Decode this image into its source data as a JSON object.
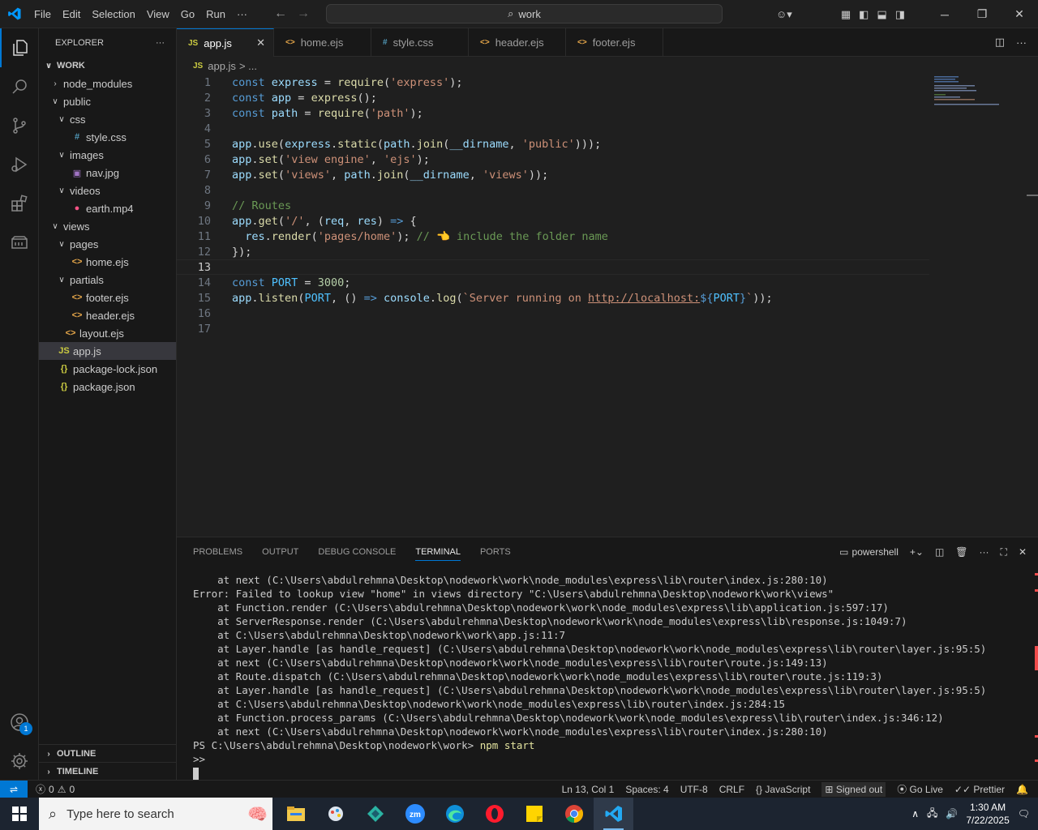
{
  "titlebar": {
    "menu": [
      "File",
      "Edit",
      "Selection",
      "View",
      "Go",
      "Run",
      "···"
    ],
    "search_text": "work"
  },
  "sidebar": {
    "title": "EXPLORER",
    "root": "WORK",
    "tree": [
      {
        "label": "node_modules",
        "indent": 1,
        "type": "folder-closed"
      },
      {
        "label": "public",
        "indent": 1,
        "type": "folder-open"
      },
      {
        "label": "css",
        "indent": 2,
        "type": "folder-open"
      },
      {
        "label": "style.css",
        "indent": 3,
        "type": "css"
      },
      {
        "label": "images",
        "indent": 2,
        "type": "folder-open"
      },
      {
        "label": "nav.jpg",
        "indent": 3,
        "type": "image"
      },
      {
        "label": "videos",
        "indent": 2,
        "type": "folder-open"
      },
      {
        "label": "earth.mp4",
        "indent": 3,
        "type": "video"
      },
      {
        "label": "views",
        "indent": 1,
        "type": "folder-open"
      },
      {
        "label": "pages",
        "indent": 2,
        "type": "folder-open"
      },
      {
        "label": "home.ejs",
        "indent": 3,
        "type": "ejs"
      },
      {
        "label": "partials",
        "indent": 2,
        "type": "folder-open"
      },
      {
        "label": "footer.ejs",
        "indent": 3,
        "type": "ejs"
      },
      {
        "label": "header.ejs",
        "indent": 3,
        "type": "ejs"
      },
      {
        "label": "layout.ejs",
        "indent": 2,
        "type": "ejs"
      },
      {
        "label": "app.js",
        "indent": 1,
        "type": "js",
        "selected": true
      },
      {
        "label": "package-lock.json",
        "indent": 1,
        "type": "json"
      },
      {
        "label": "package.json",
        "indent": 1,
        "type": "json"
      }
    ],
    "outline": "OUTLINE",
    "timeline": "TIMELINE"
  },
  "tabs": [
    {
      "label": "app.js",
      "icon": "JS",
      "active": true
    },
    {
      "label": "home.ejs",
      "icon": "<>"
    },
    {
      "label": "style.css",
      "icon": "#"
    },
    {
      "label": "header.ejs",
      "icon": "<>"
    },
    {
      "label": "footer.ejs",
      "icon": "<>"
    }
  ],
  "breadcrumb": {
    "icon": "JS",
    "file": "app.js",
    "rest": "> ..."
  },
  "code": {
    "current_line": 13,
    "lines": [
      [
        [
          "k",
          "const "
        ],
        [
          "v",
          "express "
        ],
        [
          "t",
          "= "
        ],
        [
          "f",
          "require"
        ],
        [
          "t",
          "("
        ],
        [
          "s",
          "'express'"
        ],
        [
          "t",
          ");"
        ]
      ],
      [
        [
          "k",
          "const "
        ],
        [
          "v",
          "app "
        ],
        [
          "t",
          "= "
        ],
        [
          "f",
          "express"
        ],
        [
          "t",
          "();"
        ]
      ],
      [
        [
          "k",
          "const "
        ],
        [
          "v",
          "path "
        ],
        [
          "t",
          "= "
        ],
        [
          "f",
          "require"
        ],
        [
          "t",
          "("
        ],
        [
          "s",
          "'path'"
        ],
        [
          "t",
          ");"
        ]
      ],
      [],
      [
        [
          "v",
          "app"
        ],
        [
          "t",
          "."
        ],
        [
          "f",
          "use"
        ],
        [
          "t",
          "("
        ],
        [
          "v",
          "express"
        ],
        [
          "t",
          "."
        ],
        [
          "f",
          "static"
        ],
        [
          "t",
          "("
        ],
        [
          "v",
          "path"
        ],
        [
          "t",
          "."
        ],
        [
          "f",
          "join"
        ],
        [
          "t",
          "("
        ],
        [
          "v",
          "__dirname"
        ],
        [
          "t",
          ", "
        ],
        [
          "s",
          "'public'"
        ],
        [
          "t",
          ")));"
        ]
      ],
      [
        [
          "v",
          "app"
        ],
        [
          "t",
          "."
        ],
        [
          "f",
          "set"
        ],
        [
          "t",
          "("
        ],
        [
          "s",
          "'view engine'"
        ],
        [
          "t",
          ", "
        ],
        [
          "s",
          "'ejs'"
        ],
        [
          "t",
          ");"
        ]
      ],
      [
        [
          "v",
          "app"
        ],
        [
          "t",
          "."
        ],
        [
          "f",
          "set"
        ],
        [
          "t",
          "("
        ],
        [
          "s",
          "'views'"
        ],
        [
          "t",
          ", "
        ],
        [
          "v",
          "path"
        ],
        [
          "t",
          "."
        ],
        [
          "f",
          "join"
        ],
        [
          "t",
          "("
        ],
        [
          "v",
          "__dirname"
        ],
        [
          "t",
          ", "
        ],
        [
          "s",
          "'views'"
        ],
        [
          "t",
          "));"
        ]
      ],
      [],
      [
        [
          "c",
          "// Routes"
        ]
      ],
      [
        [
          "v",
          "app"
        ],
        [
          "t",
          "."
        ],
        [
          "f",
          "get"
        ],
        [
          "t",
          "("
        ],
        [
          "s",
          "'/'"
        ],
        [
          "t",
          ", ("
        ],
        [
          "v",
          "req"
        ],
        [
          "t",
          ", "
        ],
        [
          "v",
          "res"
        ],
        [
          "t",
          ") "
        ],
        [
          "arrow",
          "=>"
        ],
        [
          "t",
          " {"
        ]
      ],
      [
        [
          "t",
          "  "
        ],
        [
          "v",
          "res"
        ],
        [
          "t",
          "."
        ],
        [
          "f",
          "render"
        ],
        [
          "t",
          "("
        ],
        [
          "s",
          "'pages/home'"
        ],
        [
          "t",
          "); "
        ],
        [
          "c",
          "// 👈 include the folder name"
        ]
      ],
      [
        [
          "t",
          "});"
        ]
      ],
      [],
      [
        [
          "k",
          "const "
        ],
        [
          "cst",
          "PORT "
        ],
        [
          "t",
          "= "
        ],
        [
          "n",
          "3000"
        ],
        [
          "t",
          ";"
        ]
      ],
      [
        [
          "v",
          "app"
        ],
        [
          "t",
          "."
        ],
        [
          "f",
          "listen"
        ],
        [
          "t",
          "("
        ],
        [
          "cst",
          "PORT"
        ],
        [
          "t",
          ", () "
        ],
        [
          "arrow",
          "=>"
        ],
        [
          "t",
          " "
        ],
        [
          "v",
          "console"
        ],
        [
          "t",
          "."
        ],
        [
          "f",
          "log"
        ],
        [
          "t",
          "("
        ],
        [
          "s",
          "`Server running on "
        ],
        [
          "u",
          "http://localhost:"
        ],
        [
          "k",
          "${"
        ],
        [
          "cst",
          "PORT"
        ],
        [
          "k",
          "}"
        ],
        [
          "s",
          "`"
        ],
        [
          "t",
          "));"
        ]
      ],
      [],
      []
    ]
  },
  "panel": {
    "tabs": [
      "PROBLEMS",
      "OUTPUT",
      "DEBUG CONSOLE",
      "TERMINAL",
      "PORTS"
    ],
    "active_tab": "TERMINAL",
    "shell": "powershell",
    "terminal_lines": [
      "    at next (C:\\Users\\abdulrehmna\\Desktop\\nodework\\work\\node_modules\\express\\lib\\router\\index.js:280:10)",
      "Error: Failed to lookup view \"home\" in views directory \"C:\\Users\\abdulrehmna\\Desktop\\nodework\\work\\views\"",
      "    at Function.render (C:\\Users\\abdulrehmna\\Desktop\\nodework\\work\\node_modules\\express\\lib\\application.js:597:17)",
      "    at ServerResponse.render (C:\\Users\\abdulrehmna\\Desktop\\nodework\\work\\node_modules\\express\\lib\\response.js:1049:7)",
      "    at C:\\Users\\abdulrehmna\\Desktop\\nodework\\work\\app.js:11:7",
      "    at Layer.handle [as handle_request] (C:\\Users\\abdulrehmna\\Desktop\\nodework\\work\\node_modules\\express\\lib\\router\\layer.js:95:5)",
      "    at next (C:\\Users\\abdulrehmna\\Desktop\\nodework\\work\\node_modules\\express\\lib\\router\\route.js:149:13)",
      "    at Route.dispatch (C:\\Users\\abdulrehmna\\Desktop\\nodework\\work\\node_modules\\express\\lib\\router\\route.js:119:3)",
      "    at Layer.handle [as handle_request] (C:\\Users\\abdulrehmna\\Desktop\\nodework\\work\\node_modules\\express\\lib\\router\\layer.js:95:5)",
      "    at C:\\Users\\abdulrehmna\\Desktop\\nodework\\work\\node_modules\\express\\lib\\router\\index.js:284:15",
      "    at Function.process_params (C:\\Users\\abdulrehmna\\Desktop\\nodework\\work\\node_modules\\express\\lib\\router\\index.js:346:12)",
      "    at next (C:\\Users\\abdulrehmna\\Desktop\\nodework\\work\\node_modules\\express\\lib\\router\\index.js:280:10)"
    ],
    "prompt": "PS C:\\Users\\abdulrehmna\\Desktop\\nodework\\work> ",
    "command": "npm start",
    "continuation": ">>"
  },
  "statusbar": {
    "errors": "0",
    "warnings": "0",
    "position": "Ln 13, Col 1",
    "spaces": "Spaces: 4",
    "encoding": "UTF-8",
    "eol": "CRLF",
    "language": "JavaScript",
    "account": "Signed out",
    "golive": "Go Live",
    "prettier": "Prettier"
  },
  "activity_badge": "1",
  "taskbar": {
    "search_placeholder": "Type here to search",
    "time": "1:30 AM",
    "date": "7/22/2025"
  },
  "colors": {
    "accent": "#0078d4",
    "bg": "#1f1f1f",
    "sidebar": "#181818"
  }
}
